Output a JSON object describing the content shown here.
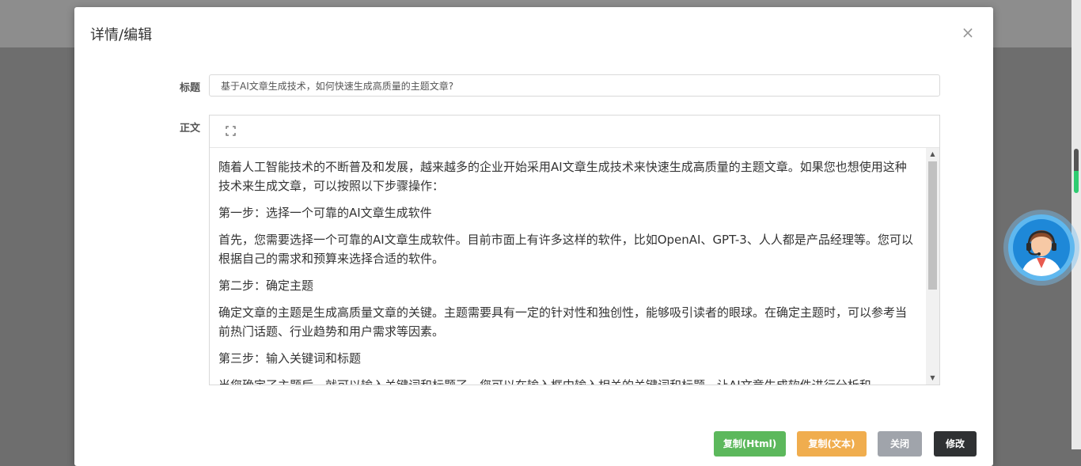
{
  "modal": {
    "title": "详情/编辑",
    "close_symbol": "×"
  },
  "form": {
    "title_label": "标题",
    "title_value": "基于AI文章生成技术，如何快速生成高质量的主题文章?",
    "body_label": "正文"
  },
  "editor": {
    "toolbar_icon": "fullscreen-icon",
    "paragraphs": [
      "随着人工智能技术的不断普及和发展，越来越多的企业开始采用AI文章生成技术来快速生成高质量的主题文章。如果您也想使用这种技术来生成文章，可以按照以下步骤操作：",
      "第一步：选择一个可靠的AI文章生成软件",
      "首先，您需要选择一个可靠的AI文章生成软件。目前市面上有许多这样的软件，比如OpenAI、GPT-3、人人都是产品经理等。您可以根据自己的需求和预算来选择合适的软件。",
      "第二步：确定主题",
      "确定文章的主题是生成高质量文章的关键。主题需要具有一定的针对性和独创性，能够吸引读者的眼球。在确定主题时，可以参考当前热门话题、行业趋势和用户需求等因素。",
      "第三步：输入关键词和标题",
      "当您确定了主题后，就可以输入关键词和标题了。您可以在输入框中输入相关的关键词和标题，让AI文章生成软件进行分析和"
    ]
  },
  "buttons": {
    "copy_html": "复制(Html)",
    "copy_text": "复制(文本)",
    "close": "关闭",
    "edit": "修改"
  },
  "colors": {
    "copy_html": "#5cb85c",
    "copy_text": "#f0ad4e",
    "close": "#a0a4ab",
    "edit": "#2f3133",
    "support_widget": "#1e88d8"
  },
  "icons": {
    "support": "customer-service-agent-icon"
  }
}
